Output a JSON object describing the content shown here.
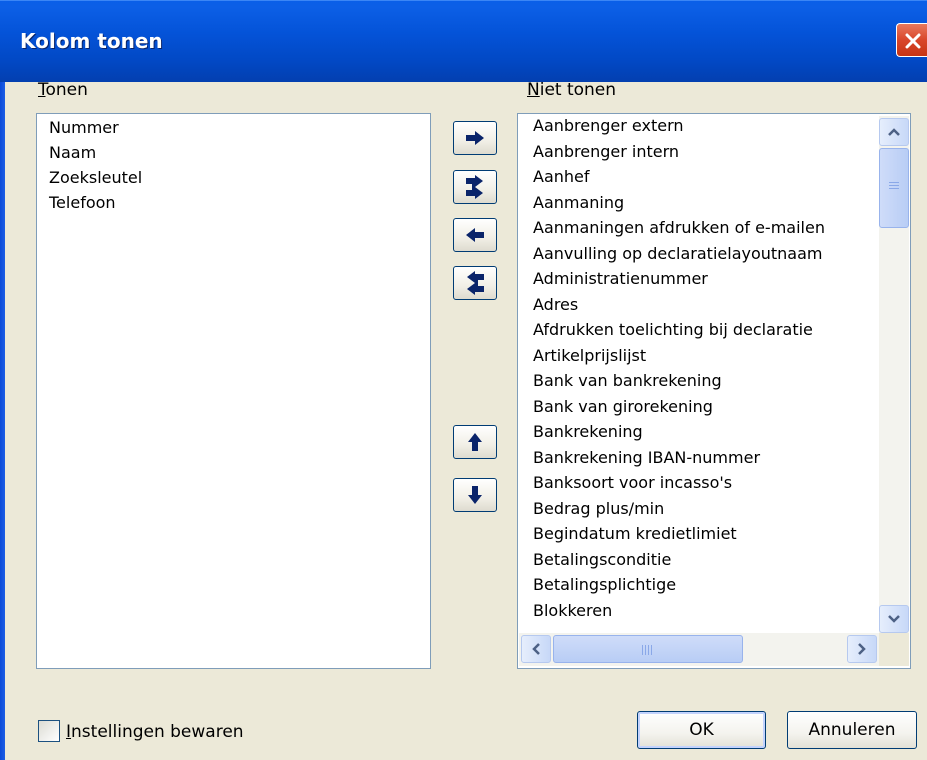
{
  "window": {
    "title": "Kolom tonen"
  },
  "shown": {
    "label_key": "T",
    "label_rest": "onen",
    "items": [
      "Nummer",
      "Naam",
      "Zoeksleutel",
      "Telefoon"
    ]
  },
  "hidden": {
    "label_key": "N",
    "label_rest": "iet tonen",
    "items": [
      "Aanbrenger extern",
      "Aanbrenger intern",
      "Aanhef",
      "Aanmaning",
      "Aanmaningen afdrukken of e-mailen",
      "Aanvulling op declaratielayoutnaam",
      "Administratienummer",
      "Adres",
      "Afdrukken toelichting bij declaratie",
      "Artikelprijslijst",
      "Bank van bankrekening",
      "Bank van girorekening",
      "Bankrekening",
      "Bankrekening IBAN-nummer",
      "Banksoort voor incasso's",
      "Bedrag plus/min",
      "Begindatum kredietlimiet",
      "Betalingsconditie",
      "Betalingsplichtige",
      "Blokkeren"
    ]
  },
  "footer": {
    "checkbox_key": "I",
    "checkbox_rest": "nstellingen bewaren",
    "ok_label": "OK",
    "cancel_label": "Annuleren"
  },
  "icons": {
    "move_right": "arrow-right-icon",
    "move_all_right": "double-arrow-right-icon",
    "move_left": "arrow-left-icon",
    "move_all_left": "double-arrow-left-icon",
    "move_up": "arrow-up-icon",
    "move_down": "arrow-down-icon",
    "close": "close-icon"
  },
  "colors": {
    "titlebar": "#0453d8",
    "close_button": "#d9462a",
    "arrow": "#0a246a"
  }
}
